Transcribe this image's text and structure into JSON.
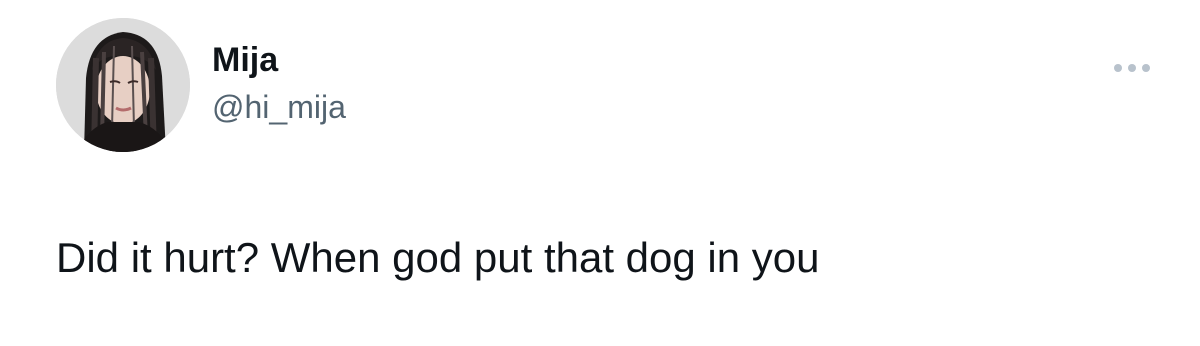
{
  "tweet": {
    "author": {
      "display_name": "Mija",
      "handle": "@hi_mija",
      "avatar_icon": "profile-photo"
    },
    "more_icon": "more-options-icon",
    "text": "Did it hurt? When god put that dog in you"
  },
  "colors": {
    "background": "#ffffff",
    "primary_text": "#0f1419",
    "secondary_text": "#536471",
    "icon_gray": "#b8c2cc"
  }
}
